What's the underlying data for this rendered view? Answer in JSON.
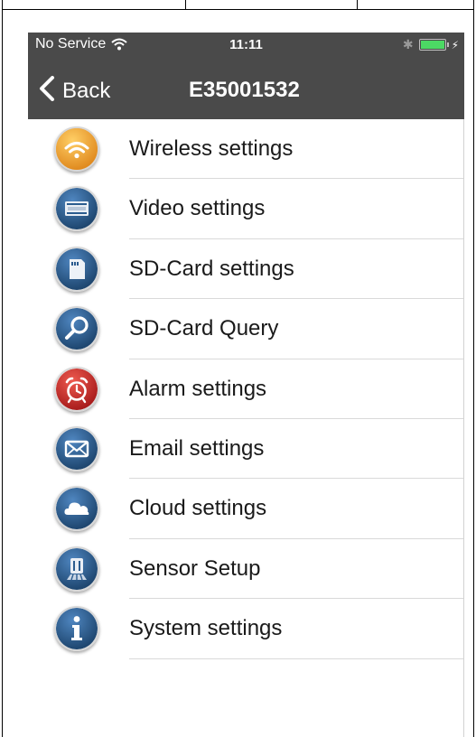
{
  "status_bar": {
    "carrier": "No Service",
    "time": "11:11"
  },
  "nav": {
    "back_label": "Back",
    "title": "E35001532"
  },
  "menu": {
    "items": [
      {
        "label": "Wireless settings",
        "icon": "wifi-icon",
        "color": "#f0a13a"
      },
      {
        "label": "Video settings",
        "icon": "film-icon",
        "color": "#2b5c8f"
      },
      {
        "label": "SD-Card settings",
        "icon": "sd-card-icon",
        "color": "#2b5c8f"
      },
      {
        "label": "SD-Card Query",
        "icon": "magnifier-icon",
        "color": "#2b5c8f"
      },
      {
        "label": "Alarm settings",
        "icon": "alarm-clock-icon",
        "color": "#c62828"
      },
      {
        "label": "Email settings",
        "icon": "envelope-icon",
        "color": "#2b5c8f"
      },
      {
        "label": "Cloud settings",
        "icon": "cloud-icon",
        "color": "#2b5c8f"
      },
      {
        "label": "Sensor Setup",
        "icon": "sensor-icon",
        "color": "#2b5c8f"
      },
      {
        "label": "System settings",
        "icon": "info-icon",
        "color": "#2b5c8f"
      }
    ]
  },
  "colors": {
    "header": "#4a4a4a",
    "icon_blue": "#2b5c8f",
    "icon_orange": "#f0a13a",
    "icon_red": "#c62828"
  }
}
